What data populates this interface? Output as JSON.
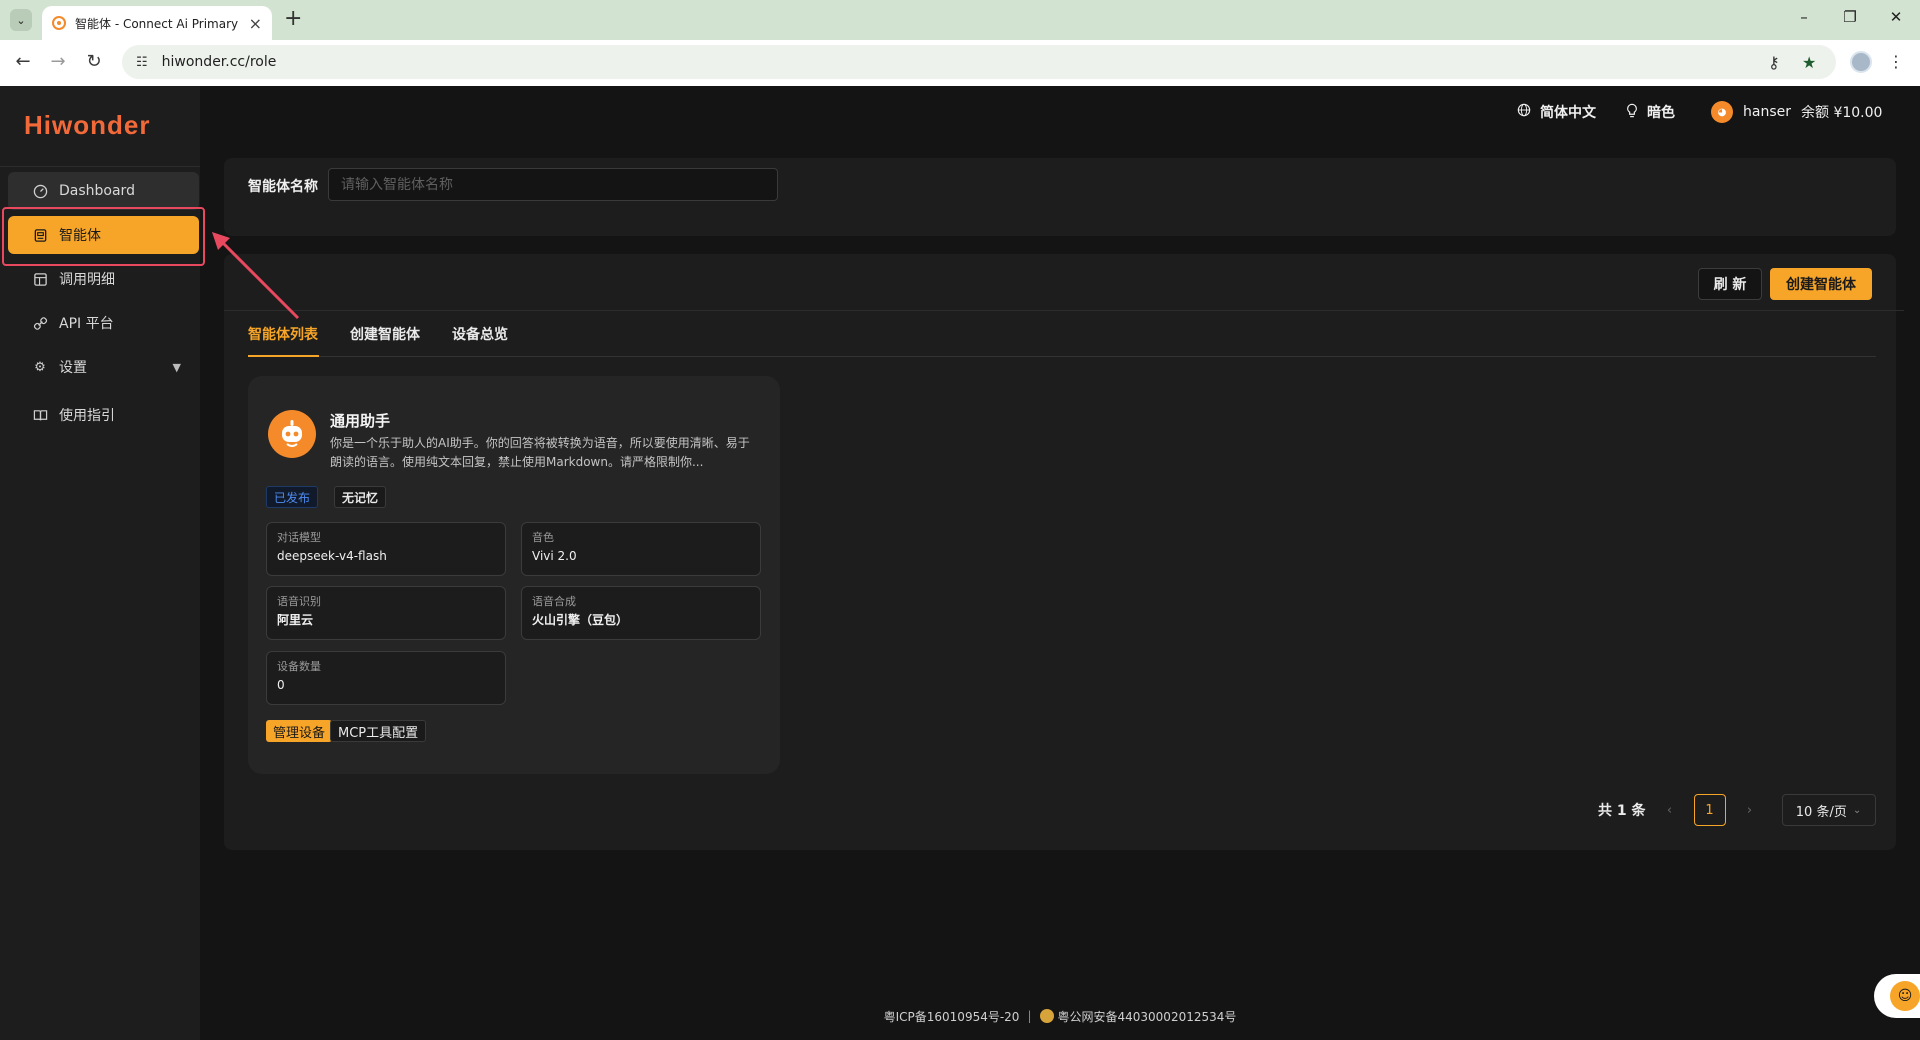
{
  "browser": {
    "tab_title": "智能体 - Connect Ai Primary",
    "url": "hiwonder.cc/role",
    "icons": {
      "tab_menu": "chevron-down-icon",
      "close": "close-icon",
      "new_tab": "plus-icon",
      "back": "arrow-left-icon",
      "forward": "arrow-right-icon",
      "reload": "reload-icon",
      "site_info": "tune-icon",
      "password": "key-icon",
      "bookmark": "star-icon",
      "more": "more-vertical-icon"
    }
  },
  "app": {
    "logo": "Hiwonder",
    "header": {
      "language": "简体中文",
      "theme": "暗色",
      "username": "hanser",
      "balance": "余额 ¥10.00"
    },
    "sidebar": {
      "items": [
        {
          "label": "Dashboard",
          "icon": "dashboard-icon"
        },
        {
          "label": "智能体",
          "icon": "agent-icon",
          "active": true
        },
        {
          "label": "调用明细",
          "icon": "details-icon"
        },
        {
          "label": "API 平台",
          "icon": "link-icon"
        },
        {
          "label": "设置",
          "icon": "gear-icon",
          "expandable": true
        },
        {
          "label": "使用指引",
          "icon": "book-icon"
        }
      ]
    },
    "filter": {
      "label": "智能体名称",
      "placeholder": "请输入智能体名称"
    },
    "toolbar": {
      "refresh": "刷 新",
      "create": "创建智能体"
    },
    "tabs": [
      "智能体列表",
      "创建智能体",
      "设备总览"
    ],
    "agent_card": {
      "name": "通用助手",
      "description": "你是一个乐于助人的AI助手。你的回答将被转换为语音，所以要使用清晰、易于朗读的语言。使用纯文本回复，禁止使用Markdown。请严格限制你...",
      "badges": {
        "status": "已发布",
        "memory": "无记忆"
      },
      "fields": [
        {
          "label": "对话模型",
          "value": "deepseek-v4-flash"
        },
        {
          "label": "音色",
          "value": "Vivi 2.0"
        },
        {
          "label": "语音识别",
          "value": "阿里云"
        },
        {
          "label": "语音合成",
          "value": "火山引擎（豆包）"
        },
        {
          "label": "设备数量",
          "value": "0"
        }
      ],
      "actions": {
        "manage": "管理设备",
        "mcp": "MCP工具配置"
      }
    },
    "pagination": {
      "total": "共 1 条",
      "current_page": "1",
      "page_size": "10 条/页"
    },
    "footer": {
      "icp": "粤ICP备16010954号-20",
      "separator": "|",
      "police": "粤公网安备44030002012534号"
    },
    "colors": {
      "accent": "#f7a528",
      "logo": "#f26a3a",
      "background": "#141414",
      "panel": "#1d1d1d",
      "highlight_annotation": "#e8495f"
    }
  }
}
